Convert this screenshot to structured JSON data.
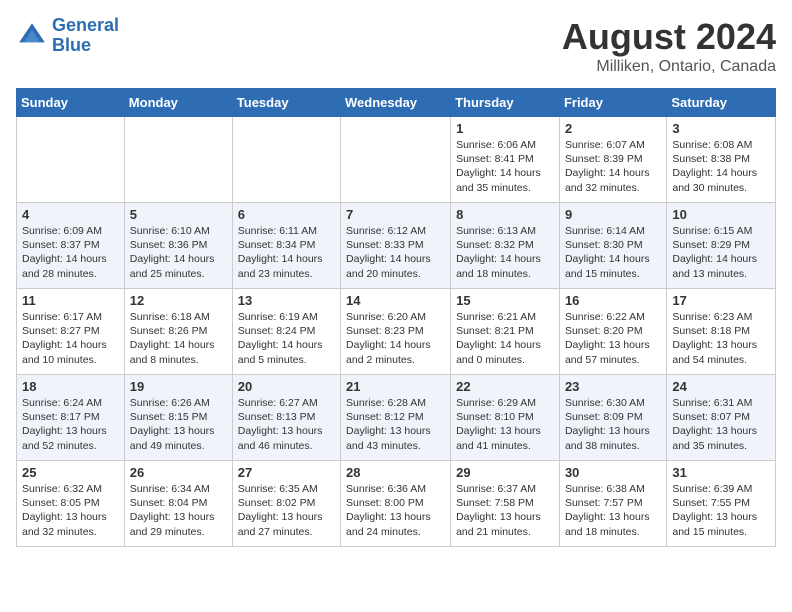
{
  "logo": {
    "line1": "General",
    "line2": "Blue"
  },
  "title": "August 2024",
  "subtitle": "Milliken, Ontario, Canada",
  "days_of_week": [
    "Sunday",
    "Monday",
    "Tuesday",
    "Wednesday",
    "Thursday",
    "Friday",
    "Saturday"
  ],
  "weeks": [
    [
      {
        "day": "",
        "info": ""
      },
      {
        "day": "",
        "info": ""
      },
      {
        "day": "",
        "info": ""
      },
      {
        "day": "",
        "info": ""
      },
      {
        "day": "1",
        "info": "Sunrise: 6:06 AM\nSunset: 8:41 PM\nDaylight: 14 hours\nand 35 minutes."
      },
      {
        "day": "2",
        "info": "Sunrise: 6:07 AM\nSunset: 8:39 PM\nDaylight: 14 hours\nand 32 minutes."
      },
      {
        "day": "3",
        "info": "Sunrise: 6:08 AM\nSunset: 8:38 PM\nDaylight: 14 hours\nand 30 minutes."
      }
    ],
    [
      {
        "day": "4",
        "info": "Sunrise: 6:09 AM\nSunset: 8:37 PM\nDaylight: 14 hours\nand 28 minutes."
      },
      {
        "day": "5",
        "info": "Sunrise: 6:10 AM\nSunset: 8:36 PM\nDaylight: 14 hours\nand 25 minutes."
      },
      {
        "day": "6",
        "info": "Sunrise: 6:11 AM\nSunset: 8:34 PM\nDaylight: 14 hours\nand 23 minutes."
      },
      {
        "day": "7",
        "info": "Sunrise: 6:12 AM\nSunset: 8:33 PM\nDaylight: 14 hours\nand 20 minutes."
      },
      {
        "day": "8",
        "info": "Sunrise: 6:13 AM\nSunset: 8:32 PM\nDaylight: 14 hours\nand 18 minutes."
      },
      {
        "day": "9",
        "info": "Sunrise: 6:14 AM\nSunset: 8:30 PM\nDaylight: 14 hours\nand 15 minutes."
      },
      {
        "day": "10",
        "info": "Sunrise: 6:15 AM\nSunset: 8:29 PM\nDaylight: 14 hours\nand 13 minutes."
      }
    ],
    [
      {
        "day": "11",
        "info": "Sunrise: 6:17 AM\nSunset: 8:27 PM\nDaylight: 14 hours\nand 10 minutes."
      },
      {
        "day": "12",
        "info": "Sunrise: 6:18 AM\nSunset: 8:26 PM\nDaylight: 14 hours\nand 8 minutes."
      },
      {
        "day": "13",
        "info": "Sunrise: 6:19 AM\nSunset: 8:24 PM\nDaylight: 14 hours\nand 5 minutes."
      },
      {
        "day": "14",
        "info": "Sunrise: 6:20 AM\nSunset: 8:23 PM\nDaylight: 14 hours\nand 2 minutes."
      },
      {
        "day": "15",
        "info": "Sunrise: 6:21 AM\nSunset: 8:21 PM\nDaylight: 14 hours\nand 0 minutes."
      },
      {
        "day": "16",
        "info": "Sunrise: 6:22 AM\nSunset: 8:20 PM\nDaylight: 13 hours\nand 57 minutes."
      },
      {
        "day": "17",
        "info": "Sunrise: 6:23 AM\nSunset: 8:18 PM\nDaylight: 13 hours\nand 54 minutes."
      }
    ],
    [
      {
        "day": "18",
        "info": "Sunrise: 6:24 AM\nSunset: 8:17 PM\nDaylight: 13 hours\nand 52 minutes."
      },
      {
        "day": "19",
        "info": "Sunrise: 6:26 AM\nSunset: 8:15 PM\nDaylight: 13 hours\nand 49 minutes."
      },
      {
        "day": "20",
        "info": "Sunrise: 6:27 AM\nSunset: 8:13 PM\nDaylight: 13 hours\nand 46 minutes."
      },
      {
        "day": "21",
        "info": "Sunrise: 6:28 AM\nSunset: 8:12 PM\nDaylight: 13 hours\nand 43 minutes."
      },
      {
        "day": "22",
        "info": "Sunrise: 6:29 AM\nSunset: 8:10 PM\nDaylight: 13 hours\nand 41 minutes."
      },
      {
        "day": "23",
        "info": "Sunrise: 6:30 AM\nSunset: 8:09 PM\nDaylight: 13 hours\nand 38 minutes."
      },
      {
        "day": "24",
        "info": "Sunrise: 6:31 AM\nSunset: 8:07 PM\nDaylight: 13 hours\nand 35 minutes."
      }
    ],
    [
      {
        "day": "25",
        "info": "Sunrise: 6:32 AM\nSunset: 8:05 PM\nDaylight: 13 hours\nand 32 minutes."
      },
      {
        "day": "26",
        "info": "Sunrise: 6:34 AM\nSunset: 8:04 PM\nDaylight: 13 hours\nand 29 minutes."
      },
      {
        "day": "27",
        "info": "Sunrise: 6:35 AM\nSunset: 8:02 PM\nDaylight: 13 hours\nand 27 minutes."
      },
      {
        "day": "28",
        "info": "Sunrise: 6:36 AM\nSunset: 8:00 PM\nDaylight: 13 hours\nand 24 minutes."
      },
      {
        "day": "29",
        "info": "Sunrise: 6:37 AM\nSunset: 7:58 PM\nDaylight: 13 hours\nand 21 minutes."
      },
      {
        "day": "30",
        "info": "Sunrise: 6:38 AM\nSunset: 7:57 PM\nDaylight: 13 hours\nand 18 minutes."
      },
      {
        "day": "31",
        "info": "Sunrise: 6:39 AM\nSunset: 7:55 PM\nDaylight: 13 hours\nand 15 minutes."
      }
    ]
  ]
}
